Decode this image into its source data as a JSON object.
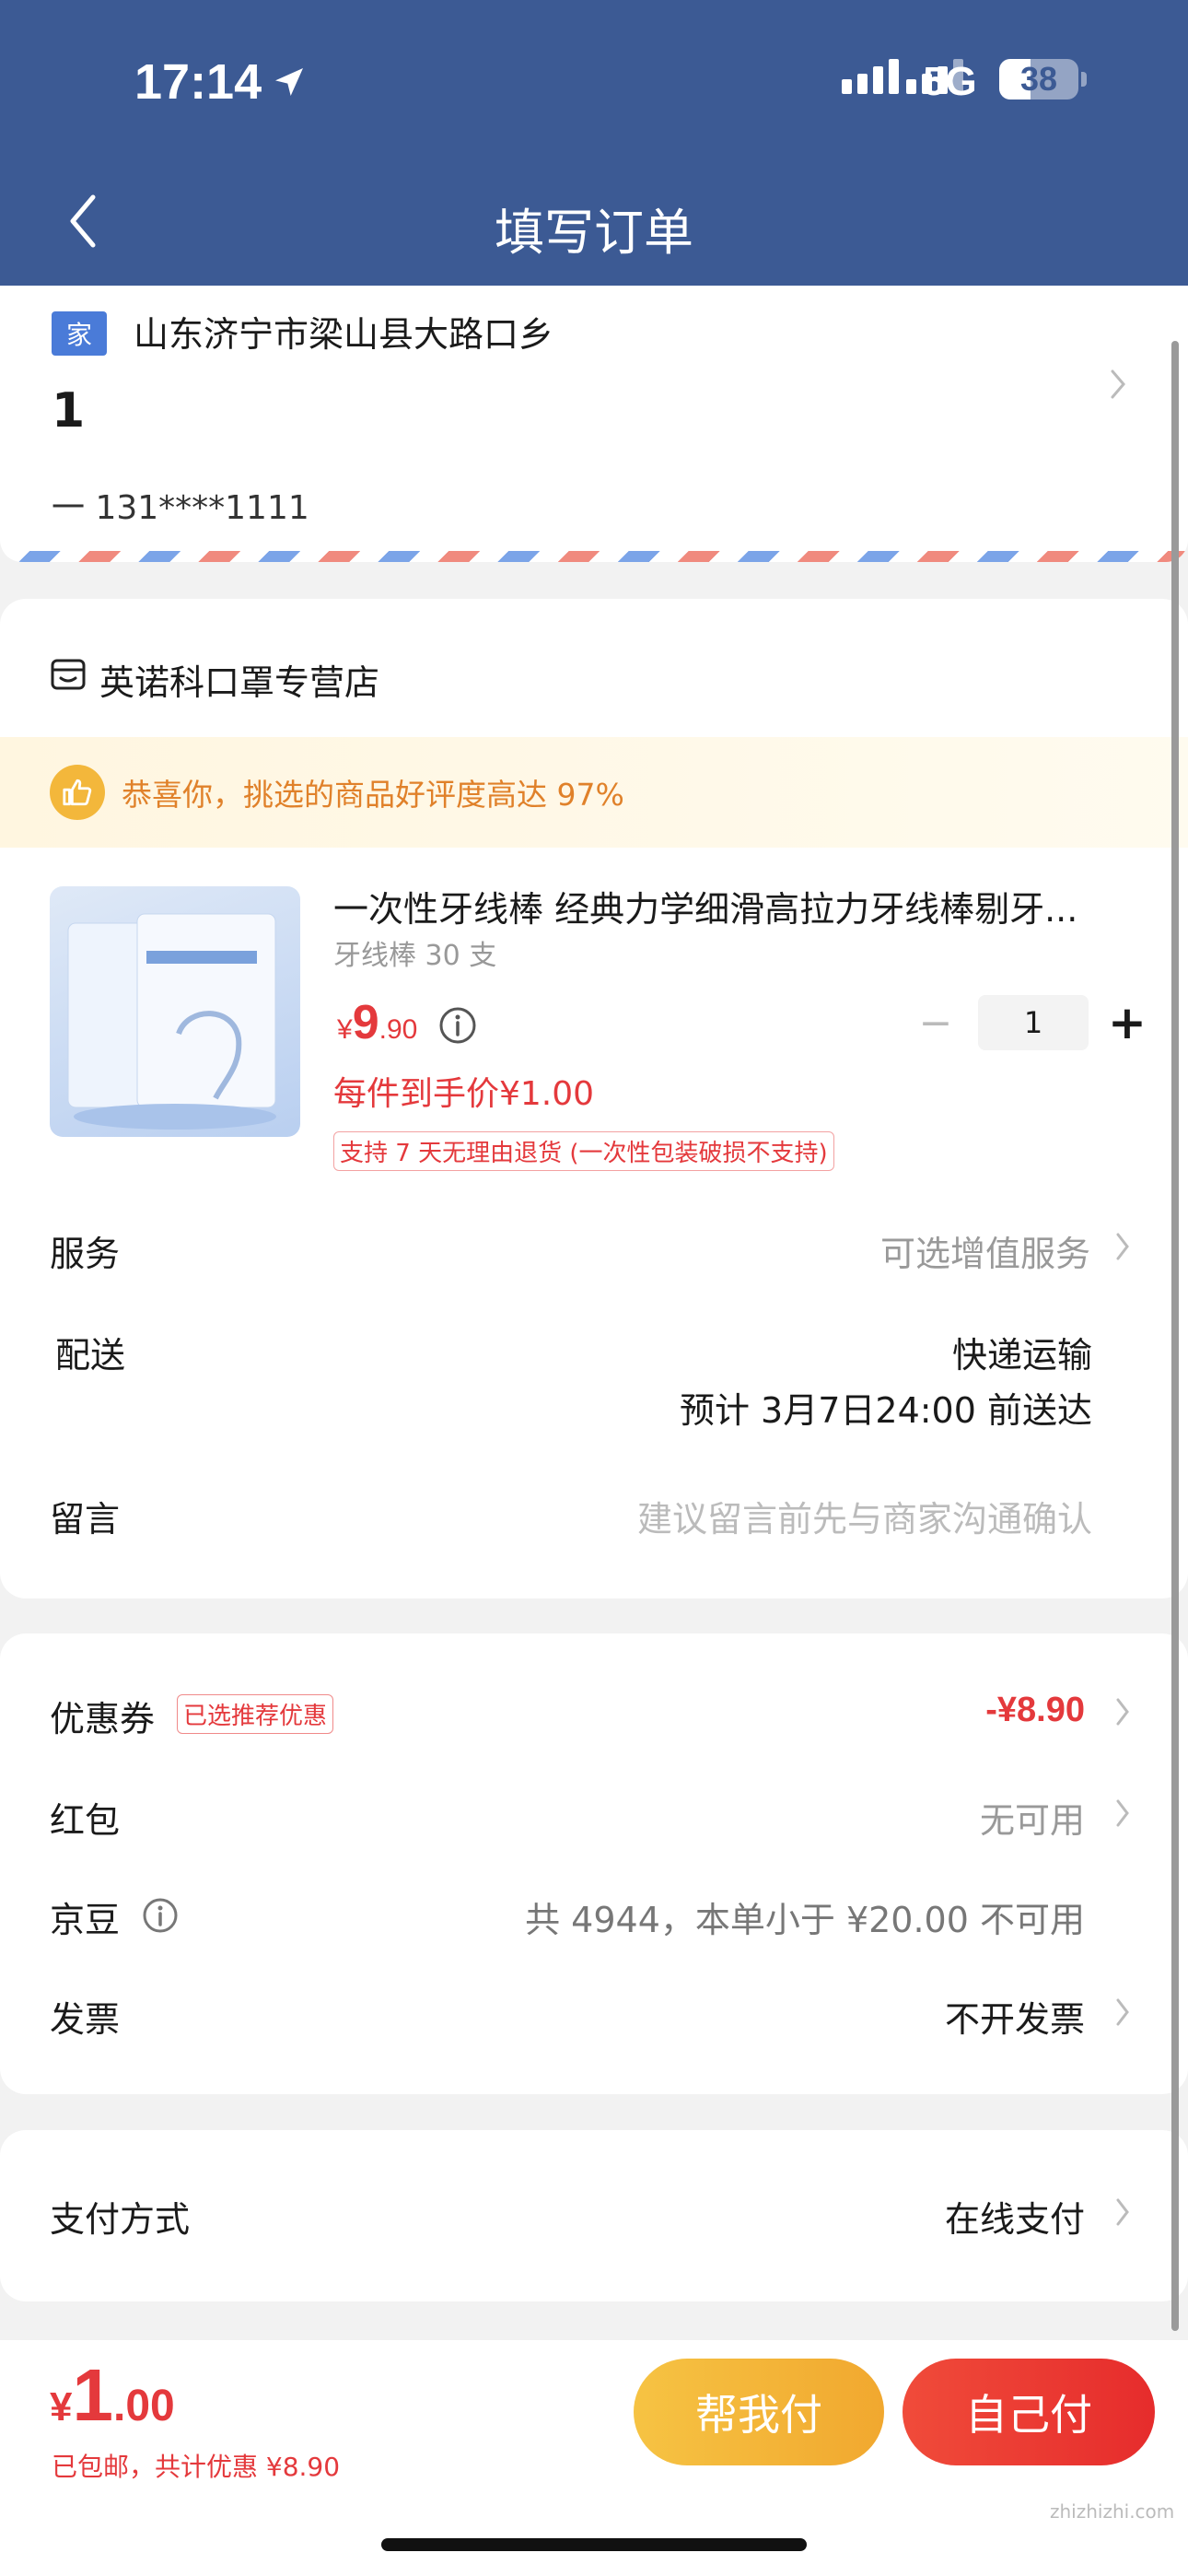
{
  "status_bar": {
    "time": "17:14",
    "network": "5G",
    "battery": "38"
  },
  "header": {
    "title": "填写订单"
  },
  "address": {
    "tag": "家",
    "line": "山东济宁市梁山县大路口乡",
    "name": "1",
    "phone": "一  131****1111"
  },
  "store": {
    "name": "英诺科口罩专营店",
    "praise_text": "恭喜你，挑选的商品好评度高达 97%"
  },
  "product": {
    "title": "一次性牙线棒 经典力学细滑高拉力牙线棒剔牙...",
    "spec": "牙线棒 30 支",
    "price_currency": "¥",
    "price_int": "9",
    "price_dec": ".90",
    "unit_price": "每件到手价¥1.00",
    "return_policy": "支持 7 天无理由退货 (一次性包装破损不支持)",
    "quantity": "1",
    "minus": "−",
    "plus": "+"
  },
  "service": {
    "label": "服务",
    "value": "可选增值服务"
  },
  "delivery": {
    "label": "配送",
    "method": "快递运输",
    "eta": "预计 3月7日24:00 前送达"
  },
  "message": {
    "label": "留言",
    "placeholder": "建议留言前先与商家沟通确认"
  },
  "discounts": {
    "coupon": {
      "label": "优惠券",
      "tag": "已选推荐优惠",
      "value": "-¥8.90"
    },
    "red_packet": {
      "label": "红包",
      "value": "无可用"
    },
    "jingdou": {
      "label": "京豆",
      "value": "共 4944，本单小于 ¥20.00 不可用"
    },
    "invoice": {
      "label": "发票",
      "value": "不开发票"
    }
  },
  "payment": {
    "label": "支付方式",
    "value": "在线支付"
  },
  "footer": {
    "currency": "¥",
    "total_int": "1",
    "total_dec": ".00",
    "note": "已包邮，共计优惠 ¥8.90",
    "help_pay": "帮我付",
    "self_pay": "自己付"
  },
  "watermark": "zhizhizhi.com",
  "colors": {
    "header": "#3c5a94",
    "accent_red": "#e4393c",
    "help_btn": "#f6c343",
    "praise_text": "#e0812a"
  }
}
